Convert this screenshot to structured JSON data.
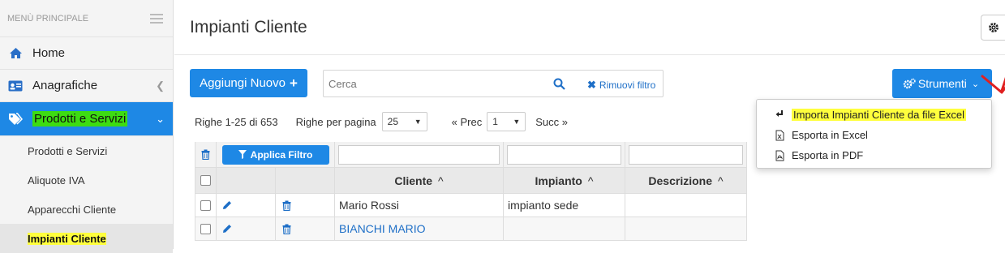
{
  "sidebar": {
    "title": "MENÙ PRINCIPALE",
    "items": [
      {
        "label": "Home",
        "icon": "home-icon"
      },
      {
        "label": "Anagrafiche",
        "icon": "id-card-icon"
      },
      {
        "label": "Prodotti e Servizi",
        "icon": "tags-icon",
        "active": true
      }
    ],
    "subitems": [
      {
        "label": "Prodotti e Servizi"
      },
      {
        "label": "Aliquote IVA"
      },
      {
        "label": "Apparecchi Cliente"
      },
      {
        "label": "Impianti Cliente",
        "active": true
      }
    ]
  },
  "header": {
    "title": "Impianti Cliente"
  },
  "toolbar": {
    "add_label": "Aggiungi Nuovo",
    "search_placeholder": "Cerca",
    "remove_filter_label": "Rimuovi filtro",
    "tools_label": "Strumenti"
  },
  "tools_menu": {
    "items": [
      {
        "label": "Importa Impianti Cliente da file Excel",
        "icon": "import-arrow-icon"
      },
      {
        "label": "Esporta in Excel",
        "icon": "excel-file-icon"
      },
      {
        "label": "Esporta in PDF",
        "icon": "pdf-file-icon"
      }
    ]
  },
  "pagination": {
    "rows_info": "Righe 1-25 di 653",
    "rows_per_page_label": "Righe per pagina",
    "rows_per_page_value": "25",
    "prev_label": "« Prec",
    "page_value": "1",
    "next_label": "Succ »"
  },
  "table": {
    "apply_filter_label": "Applica Filtro",
    "columns": [
      "Cliente",
      "Impianto",
      "Descrizione"
    ],
    "sort_glyph": "^",
    "rows": [
      {
        "cliente": "Mario Rossi",
        "impianto": "impianto sede",
        "descrizione": ""
      },
      {
        "cliente": "BIANCHI MARIO",
        "impianto": "",
        "descrizione": ""
      }
    ]
  },
  "colors": {
    "accent": "#1e88e5",
    "highlight_green": "#3ddc12",
    "highlight_yellow": "#ffff3d",
    "annotation_arrow": "#e02020"
  }
}
